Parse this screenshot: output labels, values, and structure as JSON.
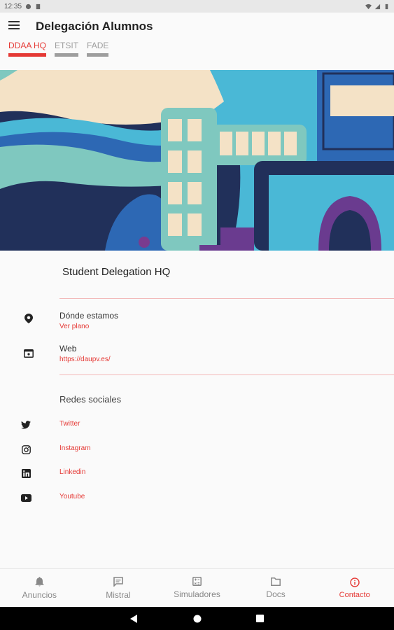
{
  "status_bar": {
    "time": "12:35"
  },
  "app": {
    "title": "Delegación Alumnos"
  },
  "tabs": [
    {
      "label": "DDAA HQ",
      "active": true
    },
    {
      "label": "ETSIT",
      "active": false
    },
    {
      "label": "FADE",
      "active": false
    }
  ],
  "place": {
    "title": "Student Delegation HQ"
  },
  "location": {
    "label": "Dónde estamos",
    "link": "Ver plano",
    "icon": "location-pin-icon"
  },
  "web": {
    "label": "Web",
    "link": "https://daupv.es/",
    "icon": "browser-window-icon"
  },
  "social": {
    "heading": "Redes sociales",
    "items": [
      {
        "label": "Twitter",
        "icon": "twitter-icon"
      },
      {
        "label": "Instagram",
        "icon": "instagram-icon"
      },
      {
        "label": "Linkedin",
        "icon": "linkedin-icon"
      },
      {
        "label": "Youtube",
        "icon": "youtube-icon"
      }
    ]
  },
  "bottom_nav": [
    {
      "label": "Anuncios",
      "icon": "bell-icon",
      "active": false
    },
    {
      "label": "Mistral",
      "icon": "chat-icon",
      "active": false
    },
    {
      "label": "Simuladores",
      "icon": "calculator-icon",
      "active": false
    },
    {
      "label": "Docs",
      "icon": "folder-icon",
      "active": false
    },
    {
      "label": "Contacto",
      "icon": "info-icon",
      "active": true
    }
  ],
  "colors": {
    "accent": "#e53935",
    "inactive": "#9e9e9e"
  }
}
